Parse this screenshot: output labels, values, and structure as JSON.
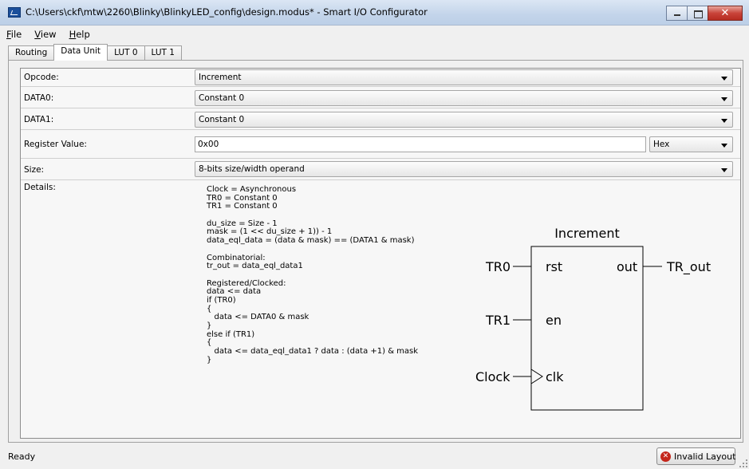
{
  "window": {
    "title": "C:\\Users\\ckf\\mtw\\2260\\Blinky\\BlinkyLED_config\\design.modus* - Smart I/O Configurator",
    "minimize_icon": "minimize-icon",
    "maximize_icon": "maximize-icon",
    "close_glyph": "✕"
  },
  "menu": [
    {
      "label": "File",
      "access": "F"
    },
    {
      "label": "View",
      "access": "V"
    },
    {
      "label": "Help",
      "access": "H"
    }
  ],
  "tabs": [
    {
      "label": "Routing",
      "active": false
    },
    {
      "label": "Data Unit",
      "active": true
    },
    {
      "label": "LUT 0",
      "active": false
    },
    {
      "label": "LUT 1",
      "active": false
    }
  ],
  "form": {
    "opcode": {
      "label": "Opcode:",
      "value": "Increment"
    },
    "data0": {
      "label": "DATA0:",
      "value": "Constant 0"
    },
    "data1": {
      "label": "DATA1:",
      "value": "Constant 0"
    },
    "register": {
      "label": "Register Value:",
      "value": "0x00",
      "format": "Hex"
    },
    "size": {
      "label": "Size:",
      "value": "8-bits size/width operand"
    },
    "details": {
      "label": "Details:",
      "lines": [
        "Clock = Asynchronous",
        "TR0 = Constant 0",
        "TR1 = Constant 0",
        "",
        "du_size = Size - 1",
        "mask = (1 << du_size + 1)) - 1",
        "data_eql_data = (data & mask) == (DATA1 & mask)",
        "",
        "Combinatorial:",
        "tr_out = data_eql_data1",
        "",
        "Registered/Clocked:",
        "data <= data",
        "if (TR0)",
        "{",
        "   data <= DATA0 & mask",
        "}",
        "else if (TR1)",
        "{",
        "   data <= data_eql_data1 ? data : (data +1) & mask",
        "}"
      ]
    }
  },
  "diagram": {
    "title": "Increment",
    "inputs": {
      "tr0": "TR0",
      "tr1": "TR1",
      "clock": "Clock"
    },
    "ports": {
      "rst": "rst",
      "en": "en",
      "clk": "clk",
      "out": "out"
    },
    "output": "TR_out"
  },
  "status": {
    "text": "Ready",
    "button_label": "Invalid Layout",
    "button_icon": "error-icon",
    "error_color": "#c4261b"
  }
}
